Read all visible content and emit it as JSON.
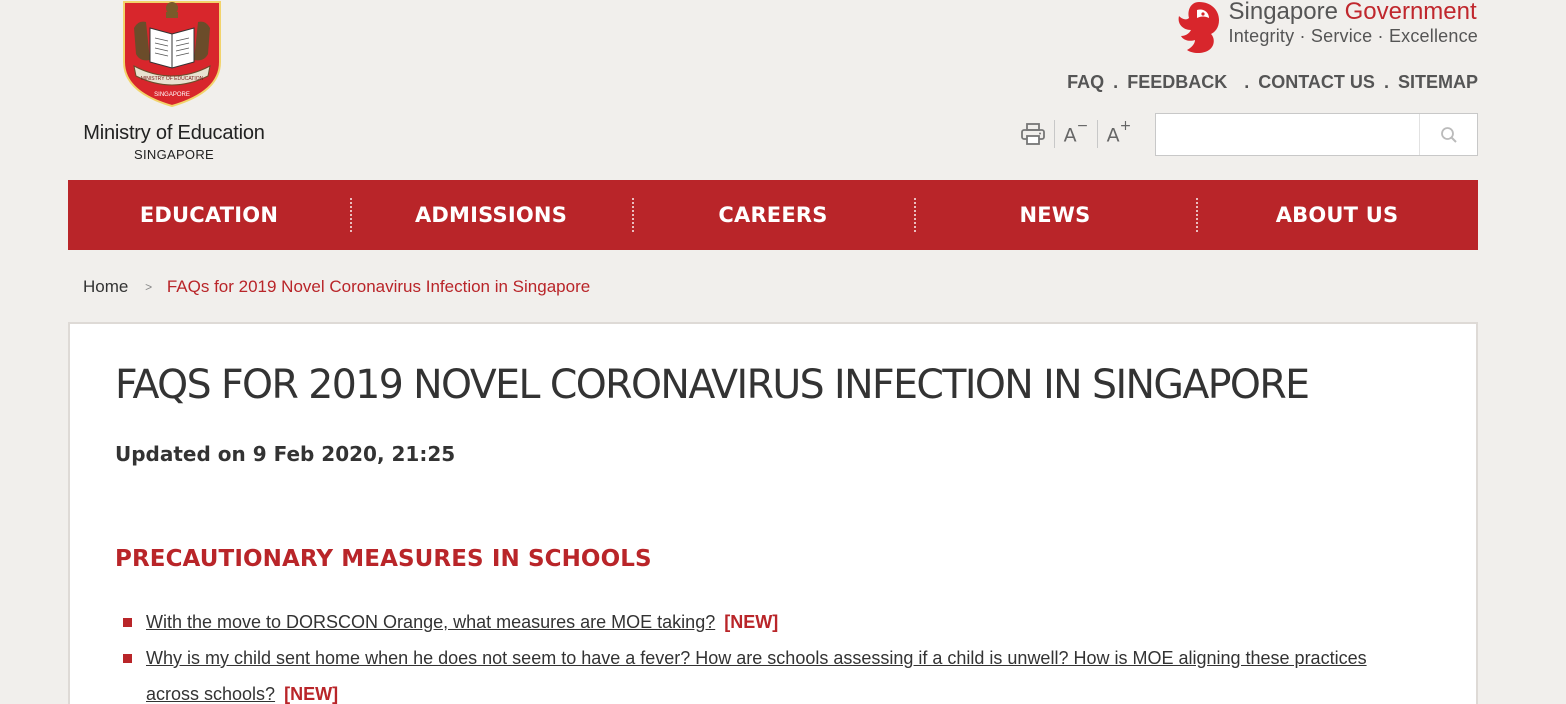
{
  "header": {
    "ministry_name": "Ministry of Education",
    "ministry_sub": "SINGAPORE",
    "crest_ribbon": "MINISTRY OF EDUCATION",
    "crest_label": "SINGAPORE",
    "gov_title_prefix": "Singapore",
    "gov_title_accent": "Government",
    "gov_tagline": "Integrity · Service · Excellence",
    "util_links": {
      "faq": "FAQ",
      "feedback": "FEEDBACK",
      "contact": "CONTACT US",
      "sitemap": "SITEMAP",
      "sep1": ".",
      "sep2": ".",
      "sep3": "."
    },
    "tools": {
      "print_icon": "printer-icon",
      "font_decrease": "A",
      "font_decrease_sup": "−",
      "font_increase": "A",
      "font_increase_sup": "+"
    },
    "search": {
      "value": "",
      "placeholder": "",
      "icon": "search-icon"
    }
  },
  "nav": {
    "items": [
      {
        "label": "EDUCATION"
      },
      {
        "label": "ADMISSIONS"
      },
      {
        "label": "CAREERS"
      },
      {
        "label": "NEWS"
      },
      {
        "label": "ABOUT US"
      }
    ]
  },
  "breadcrumb": {
    "home": "Home",
    "separator": ">",
    "current": "FAQs for 2019 Novel Coronavirus Infection in Singapore"
  },
  "content": {
    "title": "FAQS FOR 2019 NOVEL CORONAVIRUS INFECTION IN SINGAPORE",
    "updated": "Updated on 9 Feb 2020, 21:25",
    "section_heading": "PRECAUTIONARY MEASURES IN SCHOOLS",
    "faqs": [
      {
        "text": "With the move to DORSCON Orange, what measures are MOE taking?",
        "tag": "[NEW]"
      },
      {
        "text": "Why is my child sent home when he does not seem to have a fever? How are schools assessing if a child is unwell? How is MOE aligning these practices across schools?",
        "tag": "[NEW]"
      }
    ]
  },
  "colors": {
    "brand_red": "#b92529",
    "background": "#f1efec",
    "text": "#333333"
  }
}
